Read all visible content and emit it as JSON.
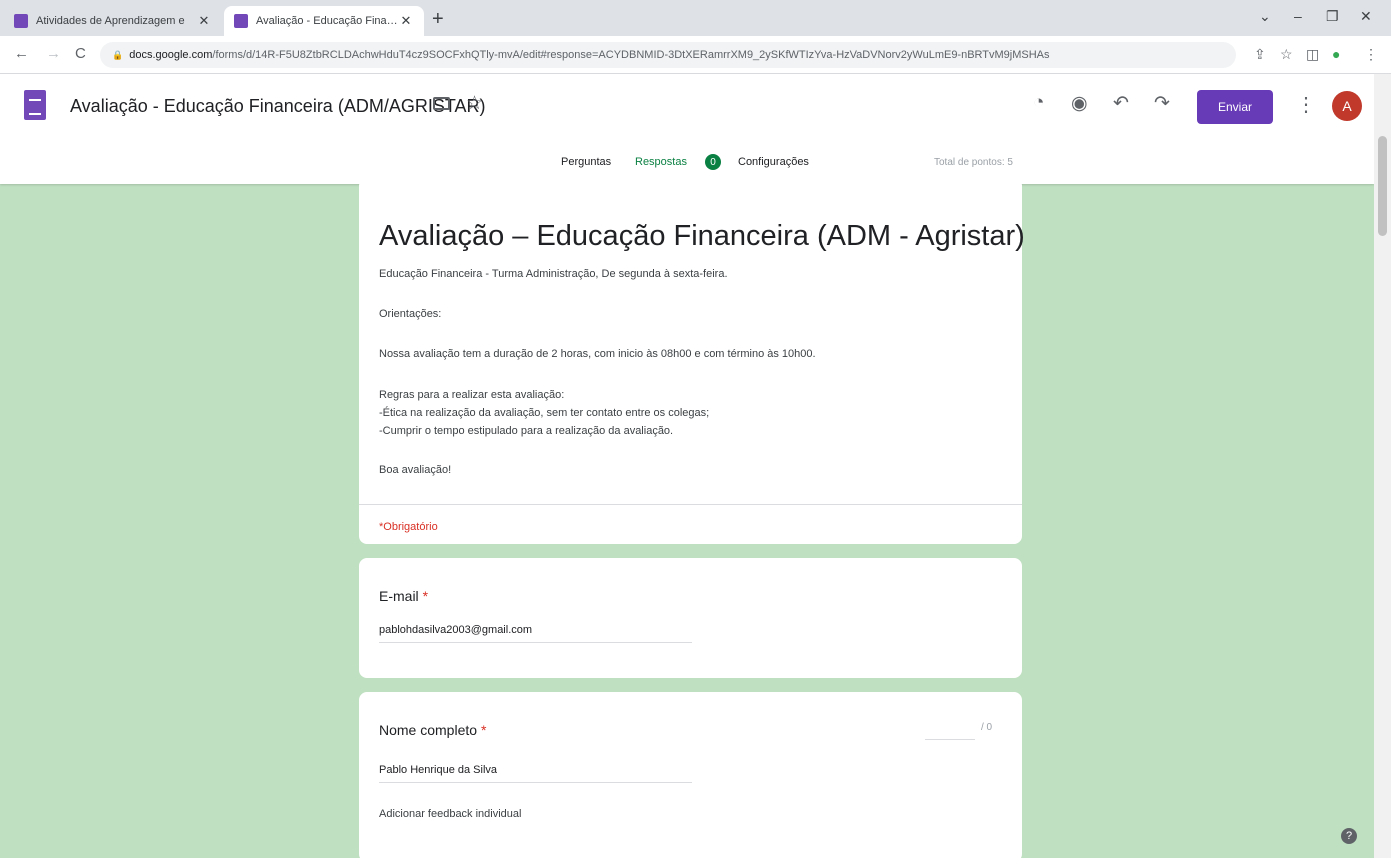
{
  "browser": {
    "tabs": [
      {
        "title": "Atividades de Aprendizagem e",
        "close": "✕"
      },
      {
        "title": "Avaliação - Educação Financeir",
        "close": "✕"
      }
    ],
    "new_tab": "+",
    "window_controls": {
      "dropdown": "⌄",
      "minimize": "–",
      "restore": "❐",
      "close": "✕"
    },
    "url_host": "docs.google.com",
    "url_path": "/forms/d/14R-F5U8ZtbRCLDAchwHduT4cz9SOCFxhQTly-mvA/edit#response=ACYDBNMID-3DtXERamrrXM9_2ySKfWTIzYva-HzVaDVNorv2yWuLmE9-nBRTvM9jMSHAs",
    "nav": {
      "back": "←",
      "forward": "→",
      "reload": "C"
    }
  },
  "header": {
    "doc_title": "Avaliação - Educação Financeira (ADM/AGRISTAR)",
    "send_label": "Enviar",
    "avatar_initial": "A"
  },
  "tabs": {
    "questions": "Perguntas",
    "responses": "Respostas",
    "responses_count": "0",
    "settings": "Configurações",
    "total_points": "Total de pontos: 5"
  },
  "form": {
    "title": "Avaliação – Educação Financeira (ADM - Agristar)",
    "description": [
      "Educação Financeira - Turma Administração, De segunda à sexta-feira.",
      "Orientações:",
      "Nossa avaliação tem a duração de  2 horas, com inicio às 08h00 e com término às 10h00.",
      "Regras para a realizar esta avaliação:",
      "-Ética na realização da avaliação, sem ter contato entre os colegas;",
      "-Cumprir o tempo estipulado para a realização da avaliação.",
      "Boa avaliação!"
    ],
    "required_note": "*Obrigatório"
  },
  "questions": [
    {
      "title": "E-mail",
      "required_mark": "*",
      "answer": "pablohdasilva2003@gmail.com"
    },
    {
      "title": "Nome completo",
      "required_mark": "*",
      "answer": "Pablo Henrique da Silva",
      "points_max": "/ 0",
      "feedback_link": "Adicionar feedback individual"
    }
  ],
  "help_label": "?"
}
